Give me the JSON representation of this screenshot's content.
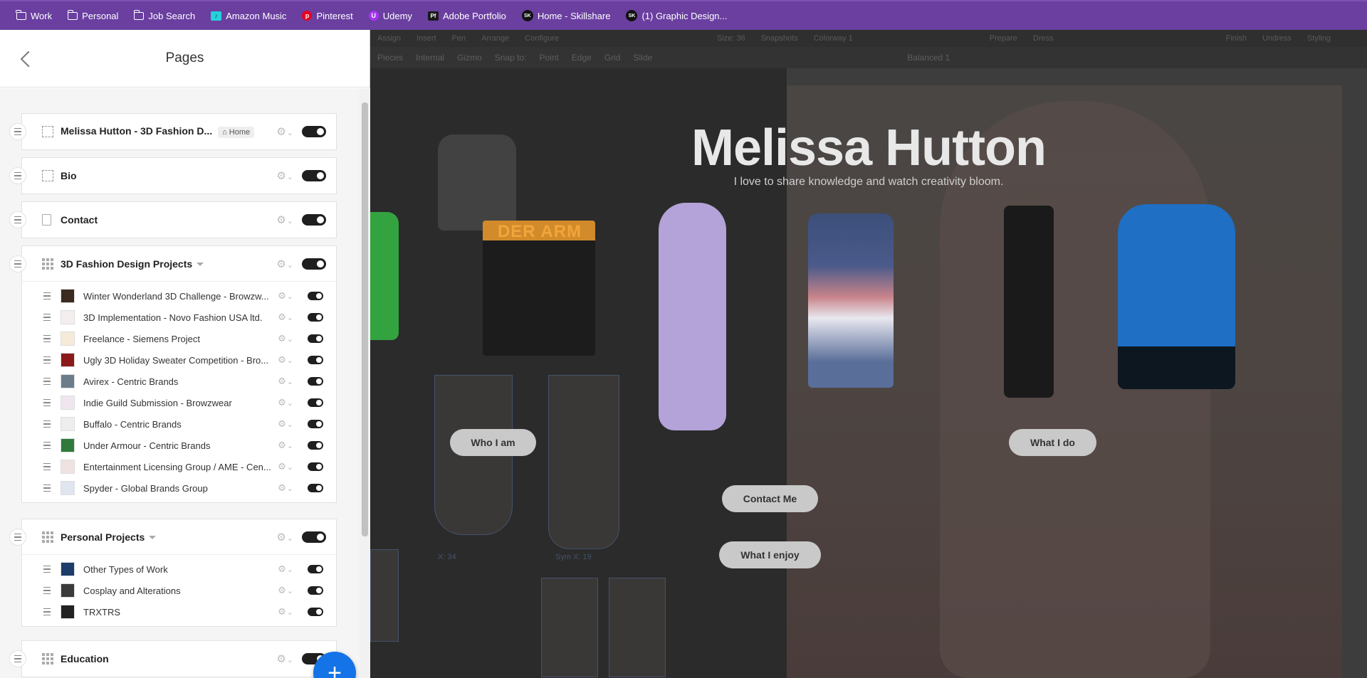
{
  "bookmarks": [
    {
      "label": "Work",
      "icon": "folder-icon"
    },
    {
      "label": "Personal",
      "icon": "folder-icon"
    },
    {
      "label": "Job Search",
      "icon": "folder-icon"
    },
    {
      "label": "Amazon Music",
      "icon": "amazon-music-icon"
    },
    {
      "label": "Pinterest",
      "icon": "pinterest-icon"
    },
    {
      "label": "Udemy",
      "icon": "udemy-icon"
    },
    {
      "label": "Adobe Portfolio",
      "icon": "adobe-portfolio-icon"
    },
    {
      "label": "Home - Skillshare",
      "icon": "skillshare-icon"
    },
    {
      "label": "(1) Graphic Design...",
      "icon": "skillshare-icon"
    }
  ],
  "panel": {
    "title": "Pages",
    "pages": [
      {
        "title": "Melissa Hutton - 3D Fashion D...",
        "badge": "Home"
      },
      {
        "title": "Bio"
      },
      {
        "title": "Contact"
      },
      {
        "title": "3D Fashion Design Projects",
        "children": [
          "Winter Wonderland 3D Challenge - Browzw...",
          "3D Implementation - Novo Fashion USA ltd.",
          "Freelance - Siemens Project",
          "Ugly 3D Holiday Sweater Competition - Bro...",
          "Avirex - Centric Brands",
          "Indie Guild Submission - Browzwear",
          "Buffalo - Centric Brands",
          "Under Armour - Centric Brands",
          "Entertainment Licensing Group / AME - Cen...",
          "Spyder - Global Brands Group"
        ]
      },
      {
        "title": "Personal Projects",
        "children": [
          "Other Types of Work",
          "Cosplay and Alterations",
          "TRXTRS"
        ]
      },
      {
        "title": "Education"
      }
    ]
  },
  "preview": {
    "toolbar": [
      "Assign",
      "Insert",
      "Pen",
      "Arrange",
      "Configure",
      "Size: 36",
      "Snapshots",
      "Colorway 1",
      "Prepare",
      "Dress",
      "Finish",
      "Undress",
      "Styling"
    ],
    "toolbar2": [
      "Pieces",
      "Internal",
      "Gizmo",
      "Snap to:",
      "Point",
      "Edge",
      "Grid",
      "Slide",
      "Balanced 1"
    ],
    "hero_title": "Melissa Hutton",
    "hero_subtitle": "I love to share knowledge and watch creativity bloom.",
    "shorts_text": "DER ARM",
    "buttons": {
      "who": "Who I am",
      "what_do": "What I do",
      "contact": "Contact Me",
      "enjoy": "What I enjoy"
    },
    "pattern_labels": [
      "X: 34",
      "Sym X: 19"
    ]
  }
}
